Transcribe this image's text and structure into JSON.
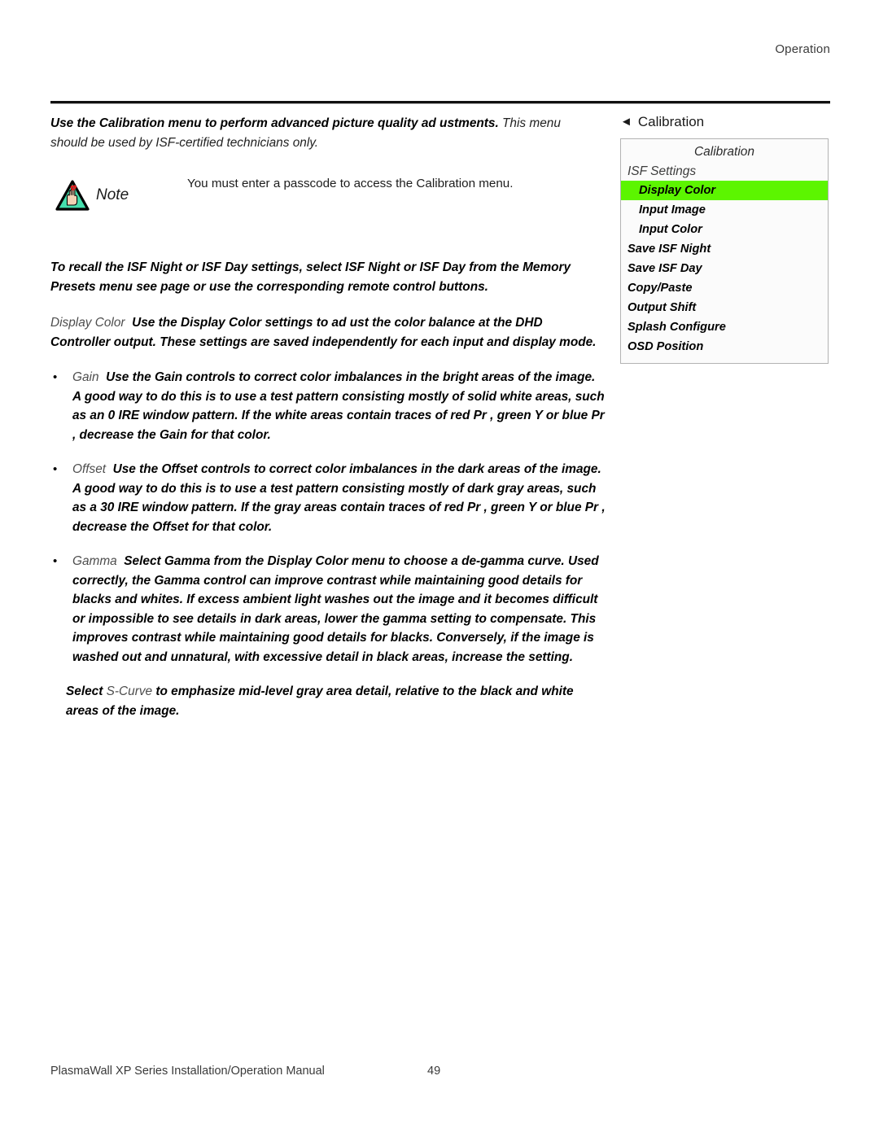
{
  "page": {
    "running_header": "Operation",
    "footer_title": "PlasmaWall XP Series Installation/Operation Manual",
    "footer_page_number": "49"
  },
  "intro": {
    "lead_bold": "Use the Calibration menu to perform advanced picture quality ad ustments.",
    "lead_rest": " This menu should be used by ISF-certified technicians only."
  },
  "note": {
    "label": "Note",
    "icon": "note-hand-triangle-icon",
    "text": "You must enter a passcode to access the Calibration menu."
  },
  "recall": {
    "text": "To recall the ISF Night or ISF Day settings, select  ISF Night  or  ISF Day  from the Memory Presets menu  see page      or use the corresponding remote control buttons."
  },
  "display_color": {
    "term": "Display Color",
    "text": "Use the Display Color settings to ad ust the color balance at the DHD Controller output. These settings are saved independently for each input and display mode."
  },
  "bullets": [
    {
      "term": "Gain",
      "text": "Use the Gain controls to correct color imbalances in the bright areas of the image. A good way to do this is to use a test pattern consisting mostly of solid white areas, such as an  0 IRE  window  pattern. If the white areas contain traces of red  Pr , green  Y  or blue  Pr , decrease the Gain for that color."
    },
    {
      "term": "Offset",
      "text": "Use the Offset controls to correct color imbalances in the dark areas of the image. A good way to do this is to use a test pattern consisting mostly of dark gray areas, such as a 30 IRE  window  pattern. If the gray areas contain traces of red  Pr , green  Y  or blue  Pr , decrease the Offset for that color."
    },
    {
      "term": "Gamma",
      "text": "Select Gamma from the Display Color menu to choose a de-gamma curve. Used correctly, the Gamma control can improve contrast while maintaining good details for blacks and whites. If excess ambient light washes out the image and it becomes difficult or impossible to see details in dark areas, lower the gamma setting to compensate. This improves contrast while maintaining good details for blacks. Conversely, if the image is washed out and unnatural, with excessive detail in black areas, increase the setting."
    }
  ],
  "scurve": {
    "prefix": "Select ",
    "term": "S-Curve",
    "text": " to emphasize mid-level  gray area  detail, relative to the black and white areas of the image."
  },
  "osd": {
    "caption_arrow": "◄",
    "caption_label": "Calibration",
    "panel_title": "Calibration",
    "group_label": "ISF Settings",
    "highlight_color": "#5cf500",
    "items": [
      {
        "label": "Display Color",
        "indent": true,
        "selected": true
      },
      {
        "label": "Input Image",
        "indent": true,
        "selected": false
      },
      {
        "label": "Input Color",
        "indent": true,
        "selected": false
      },
      {
        "label": "Save ISF Night",
        "indent": false,
        "selected": false
      },
      {
        "label": "Save ISF Day",
        "indent": false,
        "selected": false
      },
      {
        "label": "Copy/Paste",
        "indent": false,
        "selected": false
      },
      {
        "label": "Output Shift",
        "indent": false,
        "selected": false
      },
      {
        "label": "Splash Configure",
        "indent": false,
        "selected": false
      },
      {
        "label": "OSD Position",
        "indent": false,
        "selected": false
      }
    ]
  }
}
